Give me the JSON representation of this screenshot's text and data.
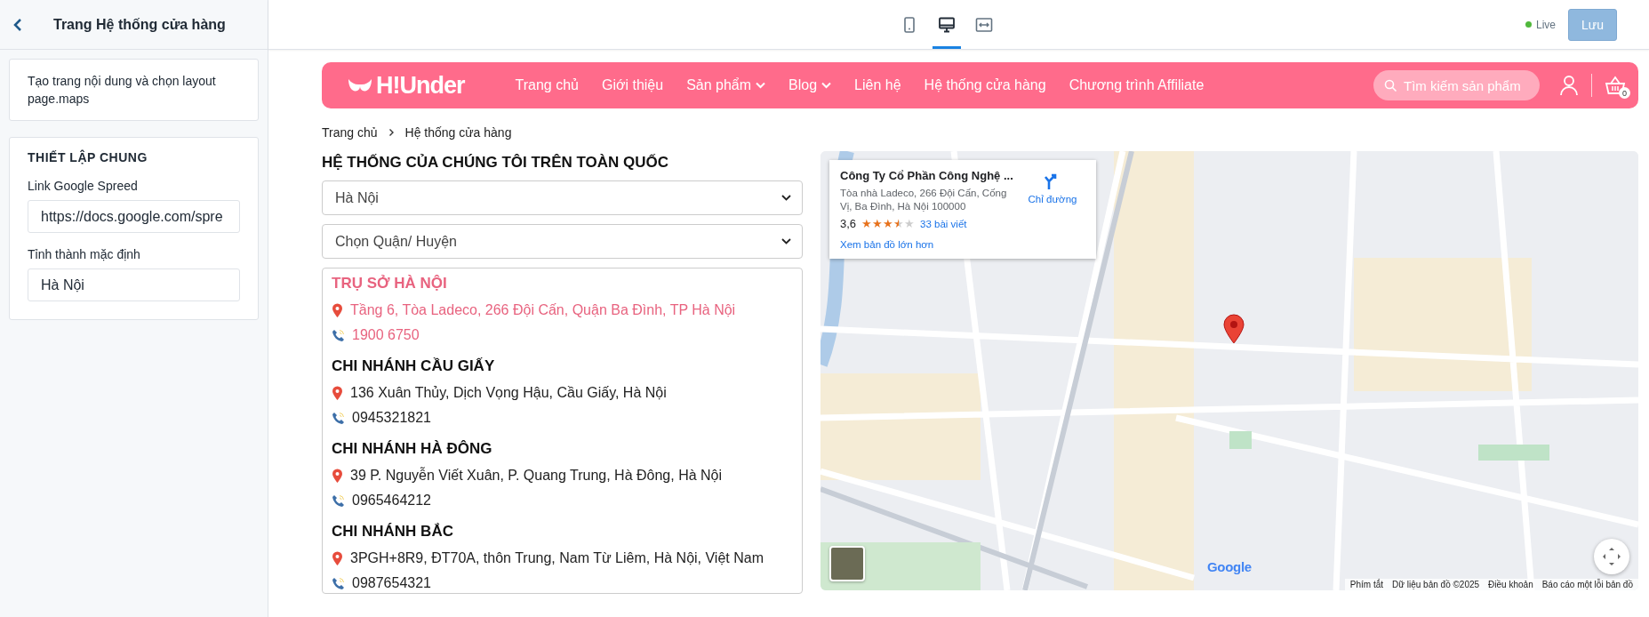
{
  "sidebar": {
    "title": "Trang Hệ thống cửa hàng",
    "note": "Tạo trang nội dung và chọn layout page.maps",
    "section": {
      "title": "THIẾT LẬP CHUNG",
      "fields": [
        {
          "label": "Link Google Spreed",
          "value": "https://docs.google.com/spre"
        },
        {
          "label": "Tỉnh thành mặc định",
          "value": "Hà Nội"
        }
      ]
    }
  },
  "toolbar": {
    "device_views": [
      {
        "kind": "mobile",
        "selected": false
      },
      {
        "kind": "desktop",
        "selected": true
      },
      {
        "kind": "fullwidth",
        "selected": false
      }
    ],
    "status": "Live",
    "save_button": "Lưu"
  },
  "store_header": {
    "logo": "H!Under",
    "menu": [
      {
        "label": "Trang chủ",
        "has_dropdown": false
      },
      {
        "label": "Giới thiệu",
        "has_dropdown": false
      },
      {
        "label": "Sản phẩm",
        "has_dropdown": true
      },
      {
        "label": "Blog",
        "has_dropdown": true
      },
      {
        "label": "Liên hệ",
        "has_dropdown": false
      },
      {
        "label": "Hệ thống cửa hàng",
        "has_dropdown": false
      },
      {
        "label": "Chương trình Affiliate",
        "has_dropdown": false
      }
    ],
    "search": {
      "placeholder": "Tìm kiếm sản phẩm"
    },
    "cart_count": "0"
  },
  "breadcrumb": [
    "Trang chủ",
    "Hệ thống cửa hàng"
  ],
  "stores_title": "HỆ THỐNG CỦA CHÚNG TÔI TRÊN TOÀN QUỐC",
  "filters": [
    {
      "value": "Hà Nội"
    },
    {
      "value": "Chọn Quận/ Huyện"
    }
  ],
  "stores": [
    {
      "name": "TRỤ SỞ HÀ NỘI",
      "address": "Tầng 6, Tòa Ladeco, 266 Đội Cấn, Quận Ba Đình, TP Hà Nội",
      "phone": "1900 6750",
      "selected": true
    },
    {
      "name": "CHI NHÁNH CẦU GIẤY",
      "address": "136 Xuân Thủy, Dịch Vọng Hậu, Cầu Giấy, Hà Nội",
      "phone": "0945321821",
      "selected": false
    },
    {
      "name": "CHI NHÁNH HÀ ĐÔNG",
      "address": "39 P. Nguyễn Viết Xuân, P. Quang Trung, Hà Đông, Hà Nội",
      "phone": "0965464212",
      "selected": false
    },
    {
      "name": "CHI NHÁNH BẮC",
      "address": "3PGH+8R9, ĐT70A, thôn Trung, Nam Từ Liêm, Hà Nội, Việt Nam",
      "phone": "0987654321",
      "selected": false
    }
  ],
  "map": {
    "place_card": {
      "name": "Công Ty Cổ Phần Công Nghệ ...",
      "address": "Tòa nhà Ladeco, 266 Đội Cấn, Cống Vị, Ba Đình, Hà Nội 100000",
      "rating": "3,6",
      "stars": 3.5,
      "reviews": "33 bài viết",
      "directions": "Chỉ đường",
      "larger_map": "Xem bản đồ lớn hơn"
    },
    "logo": "Google",
    "footer": [
      "Phím tắt",
      "Dữ liệu bản đồ ©2025",
      "Điều khoản",
      "Báo cáo một lỗi bản đồ"
    ]
  }
}
